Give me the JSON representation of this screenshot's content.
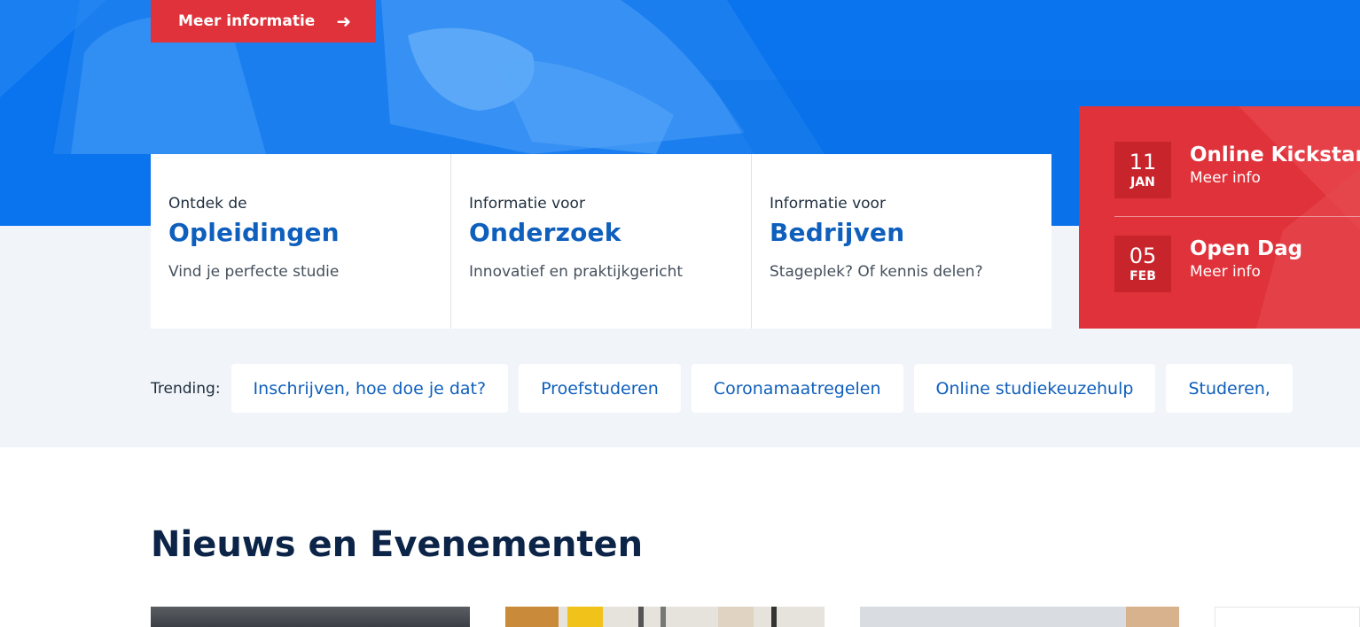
{
  "hero": {
    "cta_label": "Meer informatie",
    "cta_icon": "arrow-right-icon",
    "background_color": "#0a73ee"
  },
  "cards": [
    {
      "pre": "Ontdek de",
      "title": "Opleidingen",
      "desc": "Vind je perfecte studie"
    },
    {
      "pre": "Informatie voor",
      "title": "Onderzoek",
      "desc": "Innovatief en praktijkgericht"
    },
    {
      "pre": "Informatie voor",
      "title": "Bedrijven",
      "desc": "Stageplek? Of kennis delen?"
    }
  ],
  "events": [
    {
      "day": "11",
      "month": "JAN",
      "title": "Online Kickstart",
      "link": "Meer info"
    },
    {
      "day": "05",
      "month": "FEB",
      "title": "Open Dag",
      "link": "Meer info"
    }
  ],
  "trending": {
    "label": "Trending:",
    "items": [
      "Inschrijven, hoe doe je dat?",
      "Proefstuderen",
      "Coronamaatregelen",
      "Online studiekeuzehulp",
      "Studeren,"
    ]
  },
  "news": {
    "title": "Nieuws en Evenementen"
  },
  "colors": {
    "accent_red": "#e0323a",
    "link_blue": "#0f5fbd",
    "heading_navy": "#0b2447"
  }
}
